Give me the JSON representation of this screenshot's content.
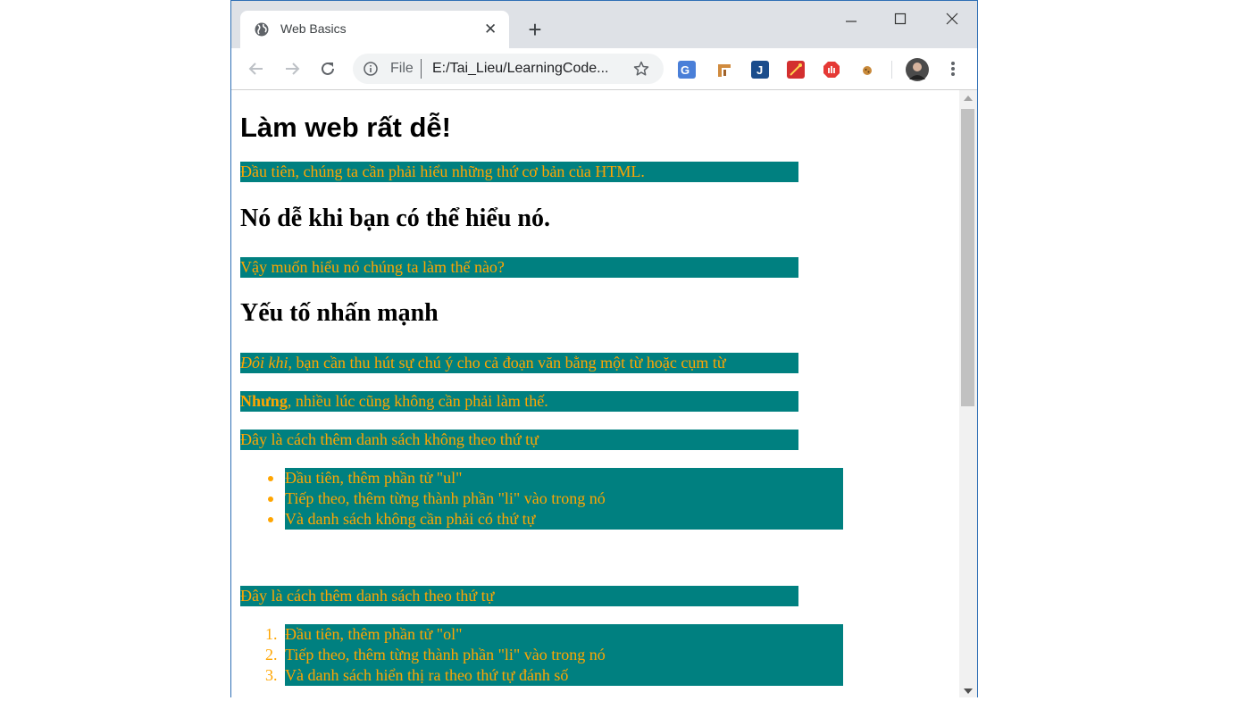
{
  "browser": {
    "tab_title": "Web Basics",
    "tab_close": "✕",
    "new_tab": "+",
    "address": {
      "scheme": "File",
      "url": "E:/Tai_Lieu/LearningCode..."
    },
    "icons": [
      "globe-icon",
      "close-icon",
      "new-tab-icon",
      "minimize-icon",
      "maximize-icon",
      "window-close-icon",
      "back-icon",
      "forward-icon",
      "reload-icon",
      "info-icon",
      "bookmark-star-icon",
      "google-translate-icon",
      "extension-icon",
      "extension-icon",
      "extension-icon",
      "adblock-icon",
      "cookie-icon",
      "profile-avatar",
      "menu-icon"
    ]
  },
  "page": {
    "h1": "Làm web rất dễ!",
    "p1": "Đầu tiên, chúng ta cần phải hiểu những thứ cơ bản của HTML.",
    "h2a": "Nó dễ khi bạn có thể hiểu nó.",
    "p2": "Vậy muốn hiểu nó chúng ta làm thế nào?",
    "h2b": "Yếu tố nhấn mạnh",
    "p3_em": "Đôi khi,",
    "p3_rest": " bạn cần thu hút sự chú ý cho cả đoạn văn bằng một từ hoặc cụm từ",
    "p4_strong": "Nhưng",
    "p4_rest": ", nhiều lúc cũng không cần phải làm thế.",
    "p5": "Đây là cách thêm danh sách không theo thứ tự",
    "ul": [
      "Đầu tiên, thêm phần tử \"ul\"",
      "Tiếp theo, thêm từng thành phần \"li\" vào trong nó",
      "Và danh sách không cần phải có thứ tự"
    ],
    "p6": "Đây là cách thêm danh sách theo thứ tự",
    "ol_markers": [
      "1.",
      "2.",
      "3."
    ],
    "ol": [
      "Đầu tiên, thêm phần tử \"ol\"",
      "Tiếp theo, thêm từng thành phần \"li\" vào trong nó",
      "Và danh sách hiển thị ra theo thứ tự đánh số"
    ]
  },
  "colors": {
    "block_bg": "#008080",
    "text": "#ffa500"
  }
}
